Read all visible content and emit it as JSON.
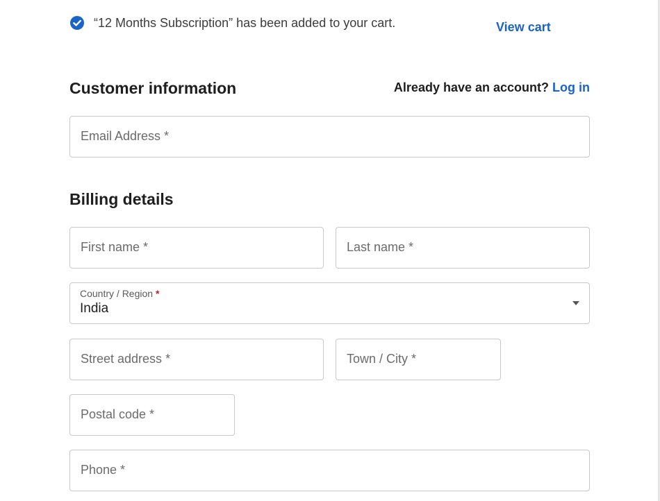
{
  "notice": {
    "message": "“12 Months Subscription” has been added to your cart.",
    "view_cart_label": "View cart",
    "icon": "check-circle-icon",
    "icon_color": "#1a63c8"
  },
  "customer": {
    "title": "Customer information",
    "account_prompt": "Already have an account?",
    "login_label": "Log in",
    "email_placeholder": "Email Address *"
  },
  "billing": {
    "title": "Billing details",
    "first_name_placeholder": "First name *",
    "last_name_placeholder": "Last name *",
    "country_label": "Country / Region",
    "country_required": "*",
    "country_value": "India",
    "street_placeholder": "Street address *",
    "city_placeholder": "Town / City *",
    "postal_placeholder": "Postal code *",
    "phone_placeholder": "Phone *"
  },
  "colors": {
    "link": "#1a63c8",
    "required": "#c0182a",
    "border": "#c9c9c9"
  }
}
